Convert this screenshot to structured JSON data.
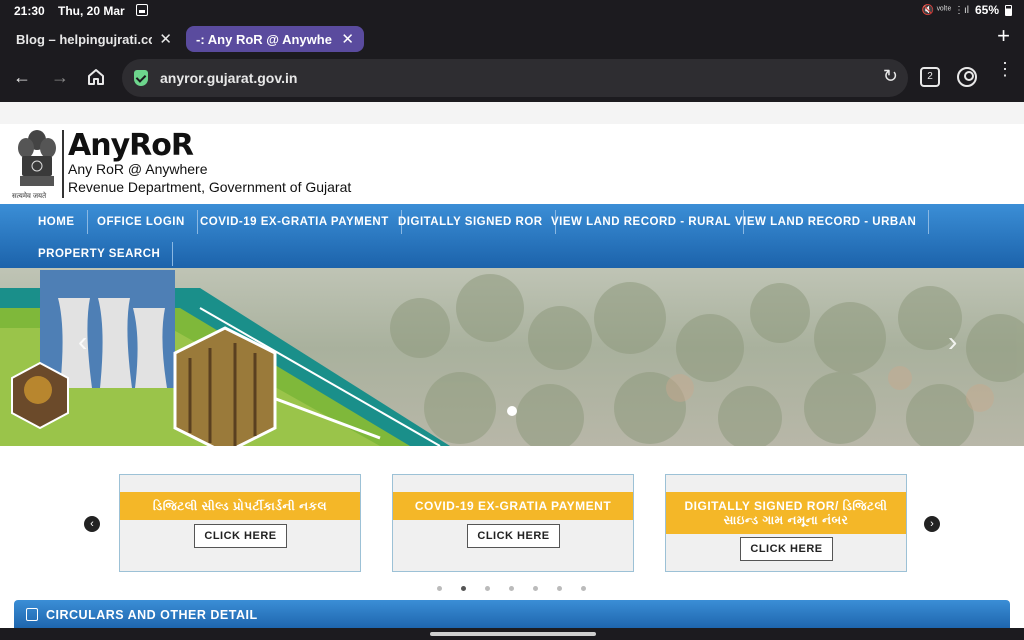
{
  "status_bar": {
    "time": "21:30",
    "date": "Thu, 20 Mar",
    "battery": "65%",
    "signal_glyphs": "🔇 ᵛᵒˡᵗᵉ ⋮ıl"
  },
  "browser": {
    "tabs": [
      {
        "title": "Blog – helpingujrati.com",
        "active": false
      },
      {
        "title": "-: Any RoR @ Anywhere :-",
        "active": true
      }
    ],
    "url": "anyror.gujarat.gov.in",
    "tab_count": "2",
    "accent_color": "#5a4b9e"
  },
  "site": {
    "title": "AnyRoR",
    "subtitle_1": "Any RoR @ Anywhere",
    "subtitle_2": "Revenue Department, Government of Gujarat",
    "emblem_caption": "सत्यमेव जयते",
    "nav": [
      "HOME",
      "OFFICE LOGIN",
      "COVID-19 EX-GRATIA PAYMENT",
      "DIGITALLY SIGNED ROR",
      "VIEW LAND RECORD - RURAL",
      "VIEW LAND RECORD - URBAN",
      "PROPERTY SEARCH"
    ],
    "nav_color": "#2a78c4"
  },
  "cards": [
    {
      "title": "ડિજિટલી સીલ્ડ પ્રોપર્ટીકાર્ડની નકલ",
      "button": "CLICK HERE"
    },
    {
      "title": "COVID-19 EX-GRATIA PAYMENT",
      "button": "CLICK HERE"
    },
    {
      "title": "DIGITALLY SIGNED ROR/ ડિજિટલી સાઇન્ડ ગામ નમૂના નંબર",
      "button": "CLICK HERE"
    }
  ],
  "carousel": {
    "dot_count": 7,
    "active_dot": 2
  },
  "circulars": {
    "label": "CIRCULARS AND OTHER DETAIL"
  },
  "icons": {
    "back": "arrow-left",
    "forward": "arrow-right",
    "home": "home",
    "reload": "reload",
    "menu": "three-dots"
  }
}
